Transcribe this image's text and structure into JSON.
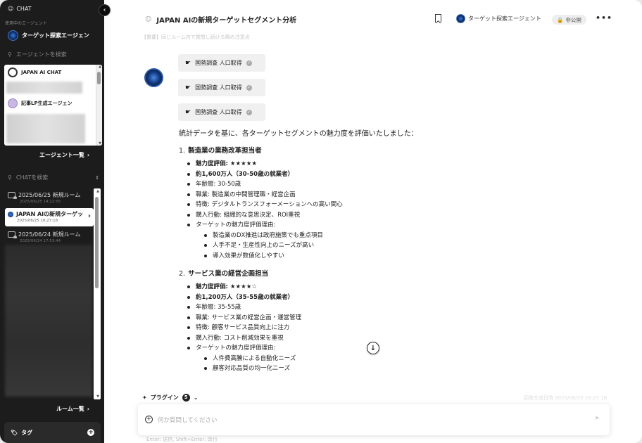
{
  "sidebar": {
    "header": "CHAT",
    "section_in_use": "使用中のエージェント",
    "active_agent": "ターゲット探索エージェン",
    "agent_search_placeholder": "エージェントを検索",
    "agents": [
      {
        "name": "JAPAN AI CHAT"
      },
      {
        "name": "記事LP生成エージェン"
      }
    ],
    "agent_list_link": "エージェント一覧",
    "chat_search_placeholder": "CHATを検索",
    "chats": [
      {
        "title": "2025/06/25 新規ルーム",
        "date": "2025/06/25 14:22:55"
      },
      {
        "title": "JAPAN AIの新規ターゲッ",
        "date": "2025/06/25 16:27:18"
      },
      {
        "title": "2025/06/24 新規ルーム",
        "date": "2025/06/24 17:53:44"
      }
    ],
    "room_list_link": "ルーム一覧",
    "tag_label": "タグ"
  },
  "header": {
    "title": "JAPAN AIの新規ターゲットセグメント分析",
    "agent_name": "ターゲット探索エージェント",
    "visibility": "非公開"
  },
  "notice": "【重要】同じルーム内で質問し続ける際の注意点",
  "tool_calls": [
    {
      "label": "国勢調査 人口取得"
    },
    {
      "label": "国勢調査 人口取得"
    },
    {
      "label": "国勢調査 人口取得"
    }
  ],
  "message": {
    "intro": "統計データを基に、各ターゲットセグメントの魅力度を評価いたしました：",
    "sections": [
      {
        "num": "1.",
        "title": "製造業の業務改革担当者",
        "rating": "魅力度評価: ★★★★★",
        "population": "約1,600万人（30-50歳の就業者）",
        "age": "年齢層: 30-50歳",
        "job": "職業: 製造業の中間管理職・経営企画",
        "trait": "特徴: デジタルトランスフォーメーションへの高い関心",
        "behavior": "購入行動: 組織的な意思決定、ROI重視",
        "reason_label": "ターゲットの魅力度評価理由:",
        "reasons": [
          "製造業のDX推進は政府施策でも重点項目",
          "人手不足・生産性向上のニーズが高い",
          "導入効果が数値化しやすい"
        ]
      },
      {
        "num": "2.",
        "title": "サービス業の経営企画担当",
        "rating": "魅力度評価: ★★★★☆",
        "population": "約1,200万人（35-55歳の就業者）",
        "age": "年齢層: 35-55歳",
        "job": "職業: サービス業の経営企画・運営管理",
        "trait": "特徴: 顧客サービス品質向上に注力",
        "behavior": "購入行動: コスト削減効果を重視",
        "reason_label": "ターゲットの魅力度評価理由:",
        "reasons": [
          "人件費高騰による自動化ニーズ",
          "顧客対応品質の均一化ニーズ"
        ]
      }
    ]
  },
  "plugin": {
    "label": "プラグイン",
    "count": "5"
  },
  "faint_right_text": "回答生成日時 2025/06/25 16:27:18",
  "composer": {
    "placeholder": "何か質問してください"
  },
  "hint": "Enter: 送信, Shift+Enter: 改行",
  "colors": {
    "sidebar_bg": "#1c1c1c",
    "accent": "#163f8a",
    "chip_bg": "#f0f0f0"
  }
}
